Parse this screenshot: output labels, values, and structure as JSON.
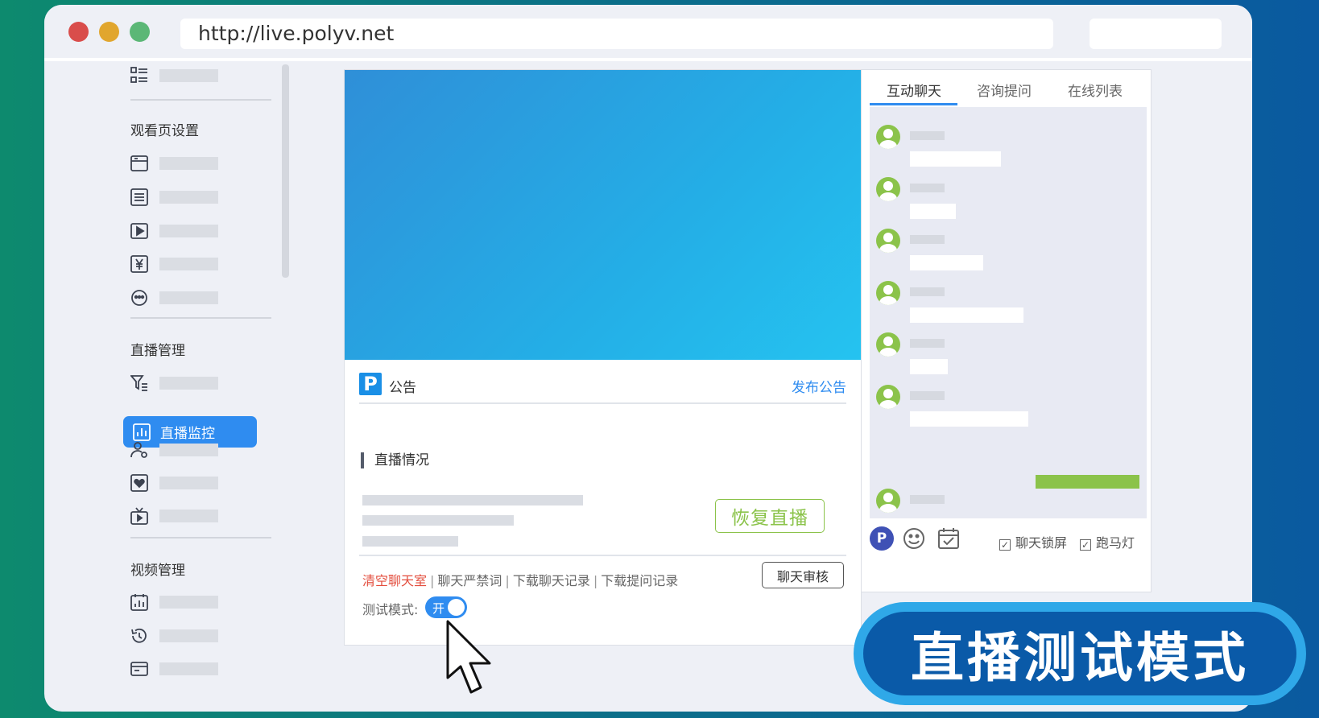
{
  "browser": {
    "url": "http://live.polyv.net"
  },
  "sidebar": {
    "sections": [
      {
        "title": "观看页设置"
      },
      {
        "title": "直播管理"
      },
      {
        "title": "视频管理"
      }
    ],
    "active_item": {
      "label": "直播监控",
      "icon": "bar-chart-icon"
    },
    "active_color": "#2f8cf0"
  },
  "player": {
    "notice_label": "公告",
    "publish_link": "发布公告",
    "status_title": "直播情况",
    "resume_button": "恢复直播",
    "ops": {
      "clear_chat": "清空聊天室",
      "banned_words": "聊天严禁词",
      "download_chat": "下载聊天记录",
      "download_questions": "下载提问记录",
      "separator": "|"
    },
    "review_button": "聊天审核",
    "test_mode_label": "测试模式:",
    "toggle_text": "开",
    "logo_letter": "P"
  },
  "chat": {
    "tabs": [
      {
        "label": "互动聊天",
        "active": true
      },
      {
        "label": "咨询提问",
        "active": false
      },
      {
        "label": "在线列表",
        "active": false
      }
    ],
    "tool_logo_letter": "P",
    "lock_screen_label": "聊天锁屏",
    "marquee_label": "跑马灯",
    "checkmark": "✓"
  },
  "overlay": {
    "caption": "直播测试模式"
  },
  "colors": {
    "accent": "#2f8cf0",
    "green": "#8bc34a",
    "danger": "#e34d3d",
    "badge_bg": "#0a5aa8"
  }
}
